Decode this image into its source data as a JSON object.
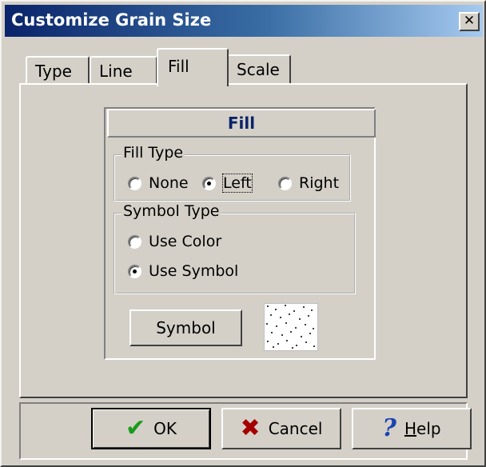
{
  "window": {
    "title": "Customize Grain Size",
    "close_glyph": "✕"
  },
  "tabs": [
    {
      "label": "Type",
      "selected": false
    },
    {
      "label": "Line",
      "selected": false
    },
    {
      "label": "Fill",
      "selected": true
    },
    {
      "label": "Scale",
      "selected": false
    }
  ],
  "fill_panel": {
    "header": "Fill",
    "fill_type": {
      "legend": "Fill Type",
      "options": [
        {
          "label": "None",
          "checked": false
        },
        {
          "label": "Left",
          "checked": true
        },
        {
          "label": "Right",
          "checked": false
        }
      ]
    },
    "symbol_type": {
      "legend": "Symbol Type",
      "options": [
        {
          "label": "Use Color",
          "checked": false
        },
        {
          "label": "Use Symbol",
          "checked": true
        }
      ]
    },
    "symbol_button": "Symbol",
    "symbol_preview_icon": "dotted-pattern-icon"
  },
  "buttons": {
    "ok": {
      "label": "OK",
      "icon": "checkmark-icon"
    },
    "cancel": {
      "label": "Cancel",
      "icon": "x-icon"
    },
    "help": {
      "label": "Help",
      "icon": "question-icon"
    }
  },
  "colors": {
    "titlebar_start": "#0a246a",
    "titlebar_end": "#a6caf0",
    "header_text": "#0a246a",
    "ok_icon": "#1a9c1a",
    "cancel_icon": "#a40000",
    "help_icon": "#1a44b0"
  }
}
